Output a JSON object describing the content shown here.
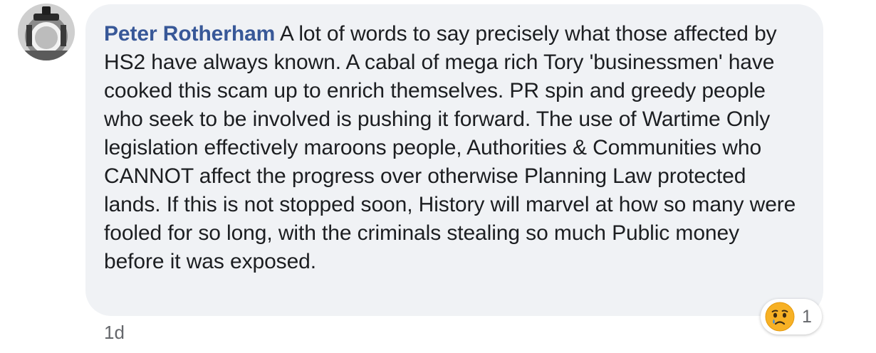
{
  "comment": {
    "author": "Peter Rotherham",
    "text": "A lot of words to say precisely what those affected by HS2 have always known. A cabal of mega rich Tory 'businessmen' have cooked this scam up to enrich themselves. PR spin and greedy people who seek to be involved is pushing it forward. The use of Wartime Only legislation effectively maroons people, Authorities & Communities who CANNOT affect the progress over otherwise Planning Law protected lands. If this is not stopped soon, History will marvel at how so many were fooled for so long, with the criminals stealing so much Public money before it was exposed.",
    "timestamp": "1d"
  },
  "reactions": {
    "icon": "sad-face-icon",
    "count": "1"
  },
  "colors": {
    "bubble": "#f0f2f5",
    "author": "#385898",
    "text": "#1c1e21",
    "meta": "#65676b",
    "reaction_face": "#f7b125",
    "tear": "#3a8ee6"
  }
}
